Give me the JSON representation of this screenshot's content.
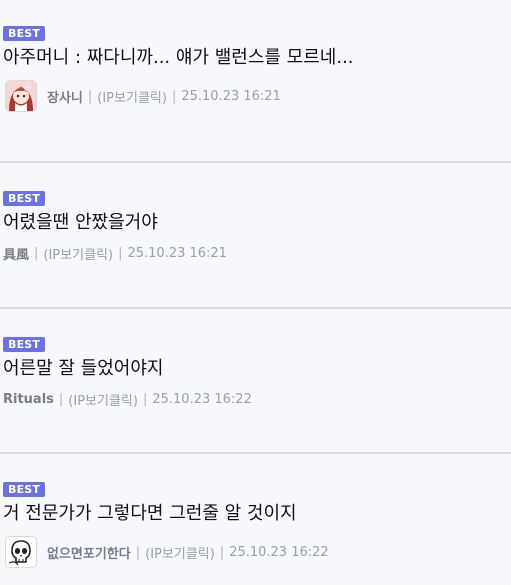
{
  "comments": [
    {
      "badge": "BEST",
      "text": "아주머니 : 짜다니까... 얘가 밸런스를 모르네...",
      "nickname": "장사니",
      "ip": "(IP보기클릭)",
      "date": "25.10.23 16:21",
      "avatar": "anime-girl-avatar"
    },
    {
      "badge": "BEST",
      "text": "어렸을땐 안짰을거야",
      "nickname": "具風",
      "ip": "(IP보기클릭)",
      "date": "25.10.23 16:21",
      "avatar": ""
    },
    {
      "badge": "BEST",
      "text": "어른말 잘 들었어야지",
      "nickname": "Rituals",
      "ip": "(IP보기클릭)",
      "date": "25.10.23 16:22",
      "avatar": ""
    },
    {
      "badge": "BEST",
      "text": "거 전문가가 그렇다면 그런줄 알 것이지",
      "nickname": "없으면포기한다",
      "ip": "(IP보기클릭)",
      "date": "25.10.23 16:22",
      "avatar": "skull-avatar"
    }
  ],
  "colors": {
    "background": "#f6f8fc",
    "badge": "#6b72e8",
    "divider": "#d9dde5",
    "meta_text": "#9aa0a9"
  }
}
